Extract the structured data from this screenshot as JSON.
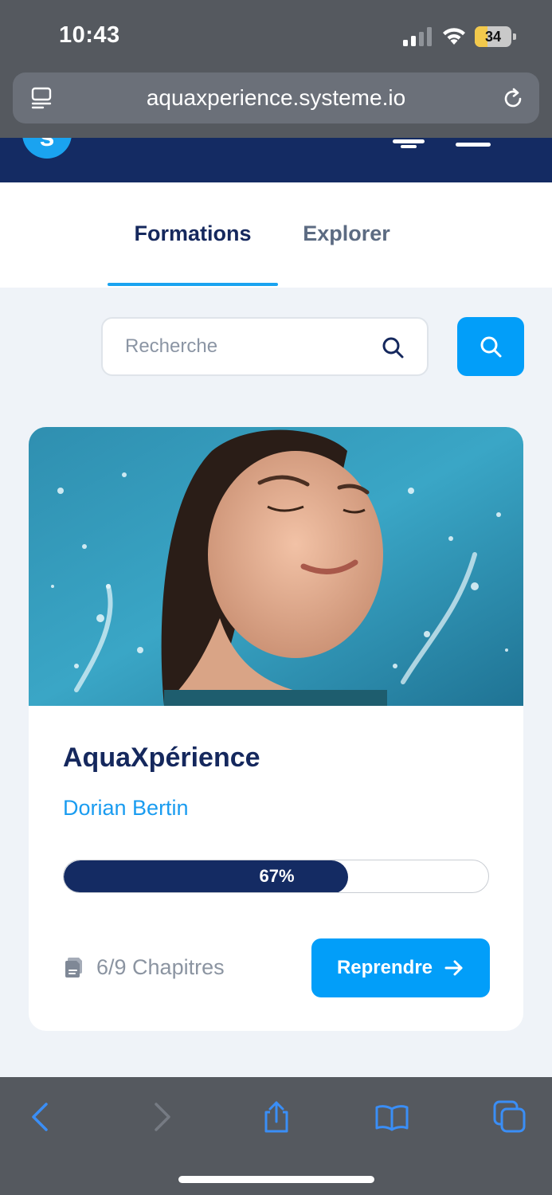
{
  "status_bar": {
    "time": "10:43",
    "battery": "34",
    "battery_level": 0.34,
    "icons": [
      "signal-icon",
      "wifi-icon",
      "battery-icon"
    ]
  },
  "browser": {
    "url": "aquaxperience.systeme.io",
    "icons": [
      "reader-icon",
      "reload-icon"
    ]
  },
  "site_header": {
    "logo": "s",
    "colors": {
      "background": "#142b63",
      "logo": "#1aa3f0"
    }
  },
  "tabs": [
    {
      "label": "Formations",
      "active": true
    },
    {
      "label": "Explorer",
      "active": false
    }
  ],
  "search": {
    "placeholder": "Recherche",
    "value": ""
  },
  "course": {
    "title": "AquaXpérience",
    "author": "Dorian Bertin",
    "progress_percent": 67,
    "progress_label": "67%",
    "chapters": "6/9 Chapitres",
    "resume_label": "Reprendre",
    "image_alt": "Femme souriante dans l'eau avec éclaboussures"
  },
  "toolbar": {
    "icons": [
      "back-icon",
      "forward-icon",
      "share-icon",
      "bookmarks-icon",
      "tabs-icon"
    ]
  },
  "colors": {
    "primary_dark": "#15285d",
    "accent": "#029ef9",
    "page_background": "#eff3f8"
  }
}
